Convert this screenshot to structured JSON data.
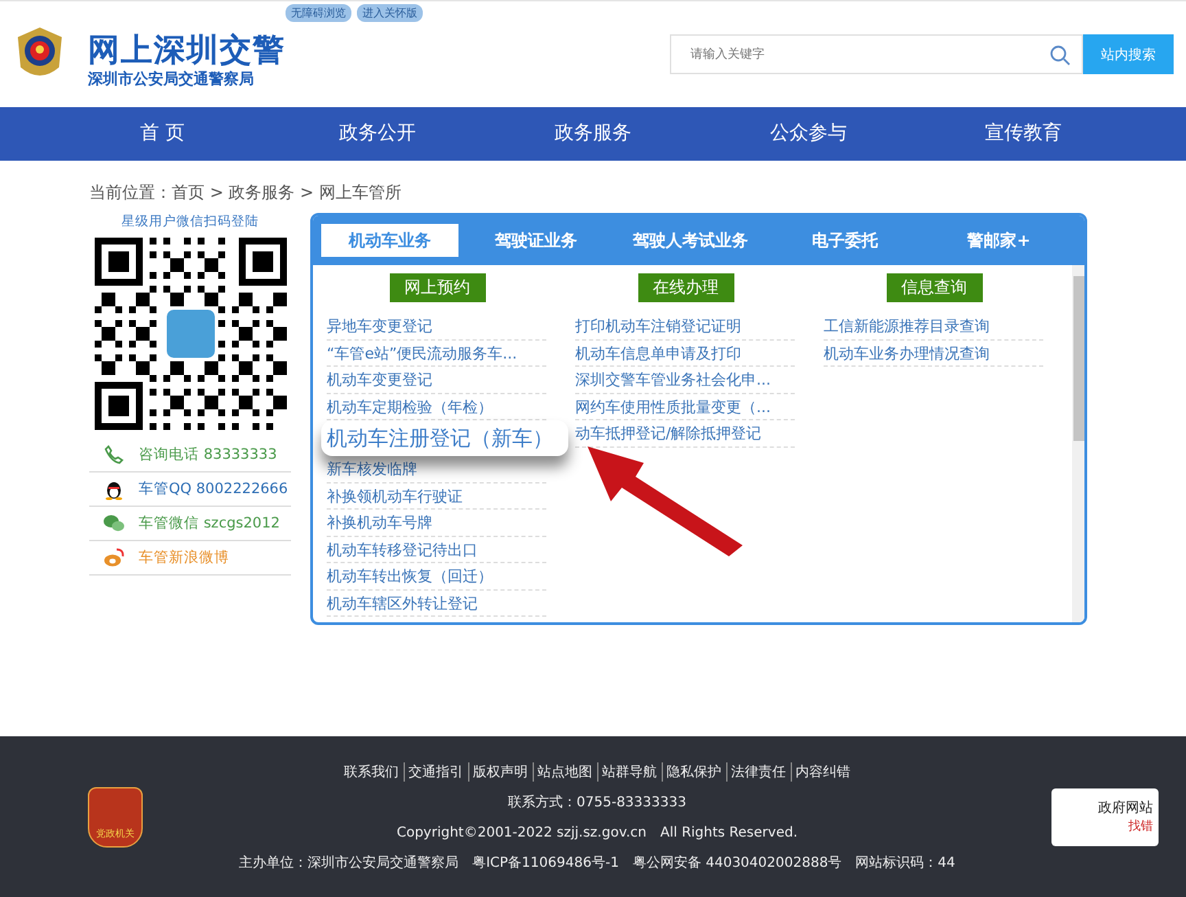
{
  "header": {
    "site_title": "网上深圳交警",
    "site_subtitle": "深圳市公安局交通警察局",
    "badges": [
      "无障碍浏览",
      "进入关怀版"
    ],
    "search": {
      "placeholder": "请输入关键字",
      "button": "站内搜索"
    }
  },
  "nav": [
    {
      "label": "首 页"
    },
    {
      "label": "政务公开"
    },
    {
      "label": "政务服务"
    },
    {
      "label": "公众参与"
    },
    {
      "label": "宣传教育"
    }
  ],
  "breadcrumb": "当前位置：首页 > 政务服务 > 网上车管所",
  "sidebar": {
    "qr_caption": "星级用户微信扫码登陆",
    "contacts": [
      {
        "kind": "phone",
        "label": "咨询电话 83333333",
        "color": "#4a9a4a"
      },
      {
        "kind": "qq",
        "label": "车管QQ 8002222666",
        "color": "#2f6fb5"
      },
      {
        "kind": "wechat",
        "label": "车管微信 szcgs2012",
        "color": "#4a9a4a"
      },
      {
        "kind": "weibo",
        "label": "车管新浪微博",
        "color": "#e8902a"
      }
    ]
  },
  "panel": {
    "tabs": [
      {
        "label": "机动车业务",
        "selected": true
      },
      {
        "label": "驾驶证业务",
        "selected": false
      },
      {
        "label": "驾驶人考试业务",
        "selected": false
      },
      {
        "label": "电子委托",
        "selected": false
      },
      {
        "label": "警邮家+",
        "selected": false
      }
    ],
    "columns": [
      {
        "heading": "网上预约",
        "items": [
          {
            "label": "异地车变更登记",
            "kind": "link"
          },
          {
            "label": "“车管e站”便民流动服务车...",
            "kind": "link"
          },
          {
            "label": "机动车变更登记",
            "kind": "link"
          },
          {
            "label": "机动车定期检验（年检）",
            "kind": "link"
          },
          {
            "label": "机动车注册登记（新车）",
            "kind": "highlighted"
          },
          {
            "label": "新车核发临牌",
            "kind": "link"
          },
          {
            "label": "补换领机动车行驶证",
            "kind": "link"
          },
          {
            "label": "补换机动车号牌",
            "kind": "link"
          },
          {
            "label": "机动车转移登记待出口",
            "kind": "link"
          },
          {
            "label": "机动车转出恢复（回迁）",
            "kind": "link"
          },
          {
            "label": "机动车辖区外转让登记",
            "kind": "link"
          }
        ]
      },
      {
        "heading": "在线办理",
        "items": [
          {
            "label": "打印机动车注销登记证明",
            "kind": "link"
          },
          {
            "label": "机动车信息单申请及打印",
            "kind": "link"
          },
          {
            "label": "深圳交警车管业务社会化申...",
            "kind": "link"
          },
          {
            "label": "网约车使用性质批量变更（...",
            "kind": "link"
          },
          {
            "label": "动车抵押登记/解除抵押登记",
            "kind": "link"
          }
        ]
      },
      {
        "heading": "信息查询",
        "items": [
          {
            "label": "工信新能源推荐目录查询",
            "kind": "link"
          },
          {
            "label": "机动车业务办理情况查询",
            "kind": "link"
          }
        ]
      }
    ]
  },
  "footer": {
    "links": [
      "联系我们",
      "交通指引",
      "版权声明",
      "站点地图",
      "站群导航",
      "隐私保护",
      "法律责任",
      "内容纠错"
    ],
    "contact": "联系方式：0755-83333333",
    "copyright": "Copyright©2001-2022 szjj.sz.gov.cn　All Rights Reserved.",
    "sponsor": "主办单位：深圳市公安局交通警察局　粤ICP备11069486号-1　粤公网安备 44030402002888号　网站标识码：44",
    "logo_caption": "党政机关",
    "gov_badge": {
      "title": "政府网站",
      "subtitle": "找错"
    }
  }
}
